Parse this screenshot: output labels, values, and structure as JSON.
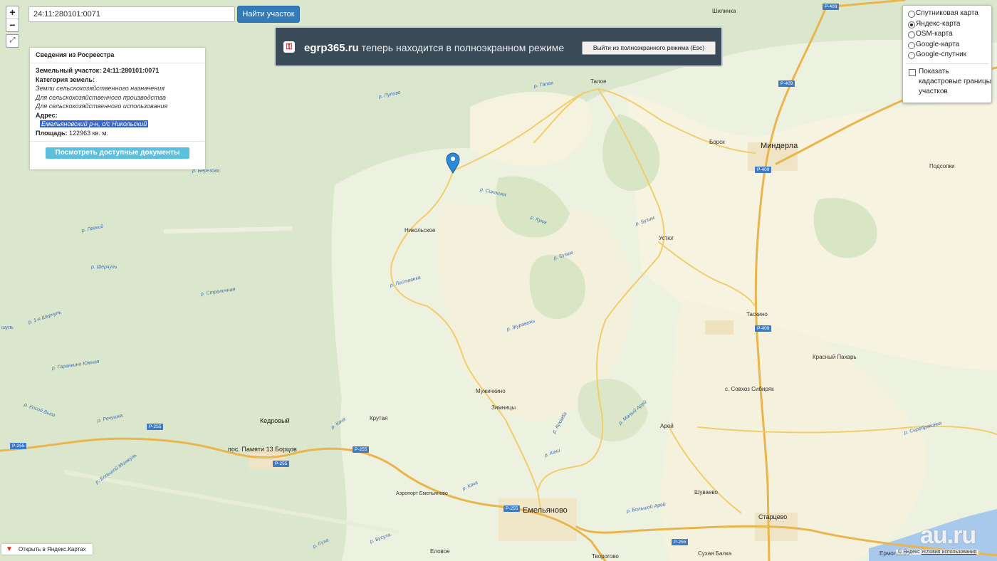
{
  "search": {
    "value": "24:11:280101:0071",
    "button": "Найти участок"
  },
  "zoom": {
    "in": "+",
    "out": "−"
  },
  "info_panel": {
    "title": "Сведения из Росреестра",
    "parcel_label": "Земельный участок:",
    "parcel_id": "24:11:280101:0071",
    "category_label": "Категория земель:",
    "categories": [
      "Земли сельскохозяйственного назначения",
      "Для сельскохозяйственного производства",
      "Для сельскохозяйственного использования"
    ],
    "address_label": "Адрес:",
    "address": "Емельяновский р-н, с/с Никольский",
    "area_label": "Площадь:",
    "area": "122963 кв. м.",
    "docs_button": "Посмотреть доступные документы"
  },
  "notice": {
    "site": "egrp365.ru",
    "text": " теперь находится в полноэкранном режиме",
    "exit_button": "Выйти из полноэкранного режима (Esc)"
  },
  "layers": {
    "options": [
      "Спутниковая карта",
      "Яндекс-карта",
      "OSM-карта",
      "Google-карта",
      "Google-спутник"
    ],
    "selected": "Яндекс-карта",
    "checkbox_label": "Показать кадастровые границы участков"
  },
  "map": {
    "places": {
      "shilinka": "Шилинка",
      "taloe": "Талое",
      "borsk": "Борск",
      "minderla": "Миндерла",
      "podsopki": "Подсопки",
      "nikolskoe": "Никольское",
      "ustyug": "Устюг",
      "taskino": "Таскино",
      "krasny_pakhar": "Красный Пахарь",
      "sovkhoz": "с. Совхоз Сибиряк",
      "muzhichkino": "Мужичкино",
      "zimnitsy": "Зимницы",
      "krutaya": "Крутая",
      "arey": "Арей",
      "kedrovy": "Кедровый",
      "pos_pamyati": "пос. Памяти 13 Борцов",
      "airport": "Аэропорт Емельяново",
      "emelyanovo": "Емельяново",
      "shuvaevo": "Шуваево",
      "startsevo": "Старцево",
      "elovoe": "Еловое",
      "tvorogovo": "Творогово",
      "sukhaya_balka": "Сухая Балка",
      "ermolaevo": "Ермолаево"
    },
    "rivers": {
      "lupovo": "р. Лупово",
      "talaya": "р. Талая",
      "berezovo": "р. Березово",
      "sinoshka": "р. Синошка",
      "kuyuk": "р. Куюк",
      "buzim1": "р. Бузим",
      "buzim2": "р. Бузим",
      "legkiy": "р. Легкий",
      "sherchul": "р. Шерчуль",
      "listvyanka": "р. Листвянка",
      "strelochnaya": "р. Стрелочная",
      "1ya_sherchul": "р. 1-я Шерчуль",
      "shul": "шуль",
      "zhuravezh": "р. Журавежь",
      "garankino": "р. Гаранкино Южная",
      "kosoy": "р. Косой Вьюз",
      "rechushka": "р. Речушка",
      "kacha": "р. Кача",
      "kuyumba": "р. Куюмба",
      "maly_arey": "р. Малый Арей",
      "kachi2": "р. Качи",
      "bolshoy_min": "р. Большой Минжуль",
      "kacha3": "р. Кача",
      "busula": "р. Бусула",
      "sukha": "р. Суха",
      "bolshoy_arey": "р. Большой Арей",
      "serebryakovka": "р. Серебряковка"
    },
    "shields": {
      "p409": "Р-409",
      "p255": "Р-255"
    }
  },
  "attribution": {
    "yandex_link": "Открыть в Яндекс.Картах",
    "copyright": "© Яндекс",
    "terms": "Условия использования"
  },
  "watermark": "au.ru"
}
